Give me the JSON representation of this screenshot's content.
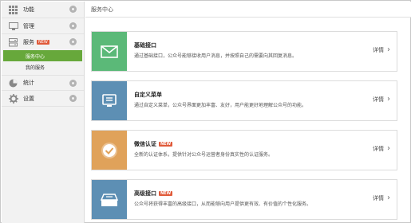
{
  "sidebar": {
    "items": [
      {
        "label": "功能",
        "icon": "grid-icon",
        "badge": ""
      },
      {
        "label": "管理",
        "icon": "monitor-icon",
        "badge": ""
      },
      {
        "label": "服务",
        "icon": "server-icon",
        "badge": "NEW"
      },
      {
        "label": "统计",
        "icon": "pie-chart-icon",
        "badge": ""
      },
      {
        "label": "设置",
        "icon": "settings-icon",
        "badge": ""
      }
    ],
    "sub_items": [
      {
        "label": "服务中心",
        "active": true
      },
      {
        "label": "我的服务",
        "active": false
      }
    ]
  },
  "header": {
    "title": "服务中心"
  },
  "cards": [
    {
      "title": "基础接口",
      "badge": "",
      "desc": "通过基础接口，公众号能够接收用户消息，并按照自己的需要向其回复消息。",
      "detail": "详情",
      "icon": "envelope-icon",
      "color": "#5bb978"
    },
    {
      "title": "自定义菜单",
      "badge": "",
      "desc": "通过自定义菜单，公众号界面更加丰富、友好，用户能更好地理解公众号的功能。",
      "detail": "详情",
      "icon": "menu-screen-icon",
      "color": "#5d8fb4"
    },
    {
      "title": "微信认证",
      "badge": "NEW",
      "desc": "全新的认证体系，提供针对公众号运营者身份真实性的认证服务。",
      "detail": "详情",
      "icon": "check-circle-icon",
      "color": "#e0a25a"
    },
    {
      "title": "高级接口",
      "badge": "NEW",
      "desc": "公众号将获得丰富的高级接口，从而能够向用户提供更有效、有价值的个性化服务。",
      "detail": "详情",
      "icon": "inbox-tray-icon",
      "color": "#5d8fb4"
    }
  ]
}
